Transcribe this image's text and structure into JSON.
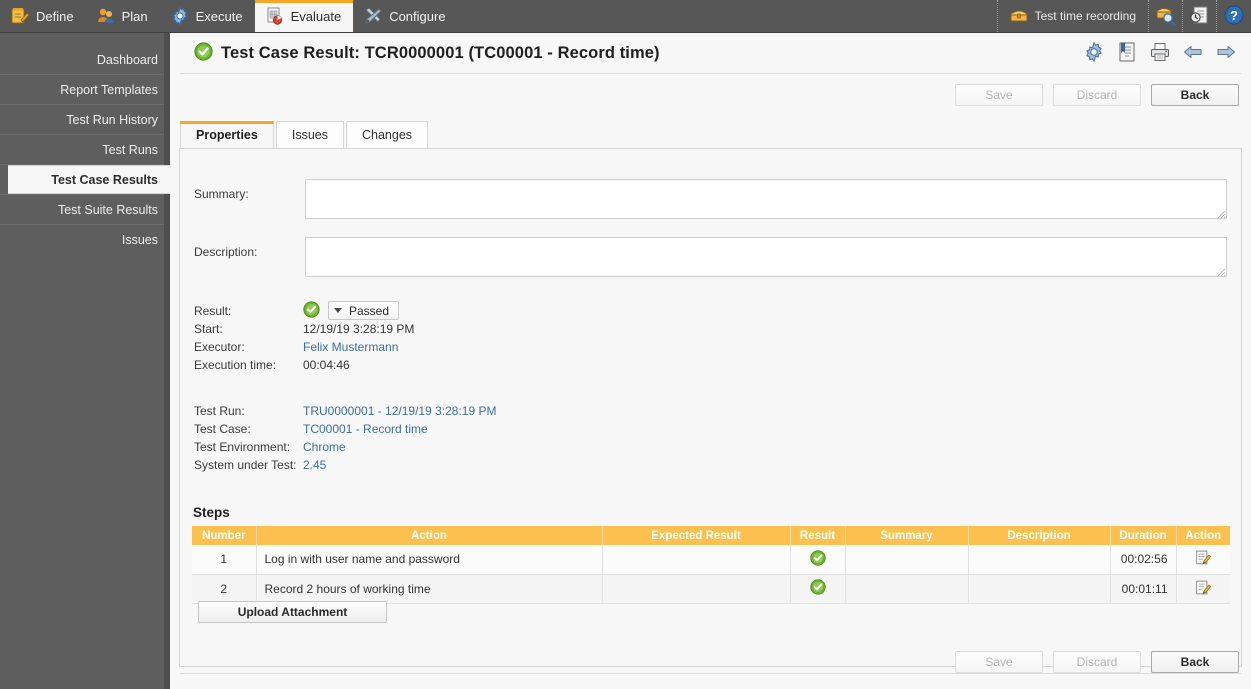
{
  "topnav": {
    "items": [
      {
        "label": "Define",
        "icon": "notepad-pencil-icon",
        "active": false
      },
      {
        "label": "Plan",
        "icon": "people-icon",
        "active": false
      },
      {
        "label": "Execute",
        "icon": "gear-blue-icon",
        "active": false
      },
      {
        "label": "Evaluate",
        "icon": "report-chart-icon",
        "active": true
      },
      {
        "label": "Configure",
        "icon": "wrench-screwdriver-icon",
        "active": false
      }
    ],
    "time_recording_label": "Test time recording",
    "time_recording_icon": "chest-box-icon",
    "right_icons": [
      {
        "name": "search-magnifier-icon"
      },
      {
        "name": "clock-document-icon"
      },
      {
        "name": "help-question-icon"
      }
    ]
  },
  "sidebar": {
    "items": [
      {
        "label": "Dashboard",
        "active": false
      },
      {
        "label": "Report Templates",
        "active": false
      },
      {
        "label": "Test Run History",
        "active": false
      },
      {
        "label": "Test Runs",
        "active": false
      },
      {
        "label": "Test Case Results",
        "active": true
      },
      {
        "label": "Test Suite Results",
        "active": false
      },
      {
        "label": "Issues",
        "active": false
      }
    ]
  },
  "header": {
    "status_icon": "green-check-circle-icon",
    "title": "Test Case Result: TCR0000001 (TC00001 - Record time)",
    "icons": [
      {
        "name": "gear-icon"
      },
      {
        "name": "bookmark-document-icon"
      },
      {
        "name": "printer-icon"
      },
      {
        "name": "arrow-left-icon"
      },
      {
        "name": "arrow-right-icon"
      }
    ]
  },
  "actions": {
    "save_label": "Save",
    "discard_label": "Discard",
    "back_label": "Back"
  },
  "tabs": [
    {
      "label": "Properties",
      "active": true
    },
    {
      "label": "Issues",
      "active": false
    },
    {
      "label": "Changes",
      "active": false
    }
  ],
  "form": {
    "summary_label": "Summary:",
    "summary_value": "",
    "summary_placeholder": "",
    "description_label": "Description:",
    "description_value": "",
    "description_placeholder": "",
    "result_label": "Result:",
    "result_value": "Passed",
    "result_icon": "green-check-circle-icon",
    "start_label": "Start:",
    "start_value": "12/19/19 3:28:19 PM",
    "executor_label": "Executor:",
    "executor_value": "Felix Mustermann",
    "execution_time_label": "Execution time:",
    "execution_time_value": "00:04:46",
    "test_run_label": "Test Run:",
    "test_run_value": "TRU0000001 - 12/19/19 3:28:19 PM",
    "test_case_label": "Test Case:",
    "test_case_value": "TC00001 - Record time",
    "test_environment_label": "Test Environment:",
    "test_environment_value": "Chrome",
    "system_under_test_label": "System under Test:",
    "system_under_test_value": "2.45"
  },
  "steps": {
    "title": "Steps",
    "columns": [
      "Number",
      "Action",
      "Expected Result",
      "Result",
      "Summary",
      "Description",
      "Duration",
      "Action"
    ],
    "rows": [
      {
        "number": "1",
        "action": "Log in with user name and password",
        "expected_result": "",
        "result_icon": "green-check-circle-icon",
        "summary": "",
        "description": "",
        "duration": "00:02:56",
        "action_icon": "edit-pencil-icon"
      },
      {
        "number": "2",
        "action": "Record 2 hours of working time",
        "expected_result": "",
        "result_icon": "green-check-circle-icon",
        "summary": "",
        "description": "",
        "duration": "00:01:11",
        "action_icon": "edit-pencil-icon"
      }
    ]
  },
  "upload": {
    "label": "Upload Attachment"
  },
  "colors": {
    "accent_orange": "#f5a623",
    "table_header": "#fbc04d",
    "link_blue": "#3a6ea5",
    "chrome_dark": "#575757",
    "sidebar": "#5e5e5e",
    "status_green": "#5aad27"
  }
}
